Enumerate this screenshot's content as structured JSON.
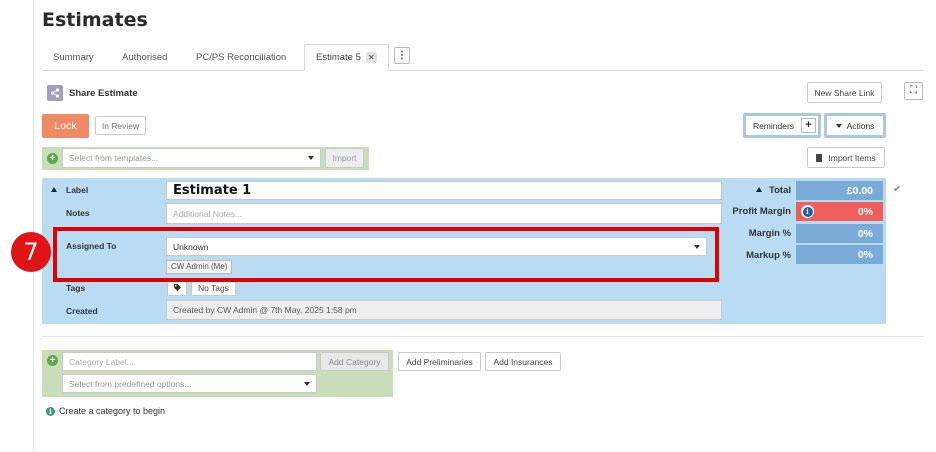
{
  "page": {
    "title": "Estimates"
  },
  "tabs": [
    {
      "label": "Summary"
    },
    {
      "label": "Authorised"
    },
    {
      "label": "PC/PS Reconciliation"
    },
    {
      "label": "Estimate 5",
      "active": true,
      "close": "✕"
    }
  ],
  "tab_more_icon": "⋮",
  "fullscreen_icon": "⛶",
  "share": {
    "title": "Share Estimate",
    "new_link": "New Share Link"
  },
  "toolbar": {
    "lock": "Lock",
    "status": "In Review",
    "reminders": "Reminders",
    "reminders_add": "+",
    "actions": "Actions",
    "import_items": "Import Items"
  },
  "templates": {
    "placeholder": "Select from templates...",
    "import": "Import"
  },
  "estimate": {
    "label_heading": "Label",
    "label_value": "Estimate 1",
    "notes_heading": "Notes",
    "notes_placeholder": "Additional Notes...",
    "assigned_heading": "Assigned To",
    "assigned_value": "Unknown",
    "assigned_tag": "CW Admin (Me)",
    "tags_heading": "Tags",
    "tags_value": "No Tags",
    "created_heading": "Created",
    "created_value": "Created by CW Admin @ 7th May, 2025 1:58 pm"
  },
  "summary": {
    "total_label": "Total",
    "total_value": "£0.00",
    "profit_label": "Profit Margin",
    "profit_value": "0%",
    "margin_label": "Margin %",
    "margin_value": "0%",
    "markup_label": "Markup %",
    "markup_value": "0%",
    "check_icon": "✔",
    "info_icon": "i"
  },
  "annotation": {
    "step": "7"
  },
  "category": {
    "label_placeholder": "Category Label...",
    "add_category": "Add Category",
    "add_preliminaries": "Add Preliminaries",
    "add_insurances": "Add Insurances",
    "predefined_placeholder": "Select from predefined options...",
    "hint": "Create a category to begin"
  },
  "colors": {
    "lock": "#ef8a64",
    "panel": "#b9dcf2",
    "summary_value": "#7aaad8",
    "profit_value": "#ee5f5c",
    "green_bar": "#c8ddb8",
    "highlight": "#e00000"
  }
}
